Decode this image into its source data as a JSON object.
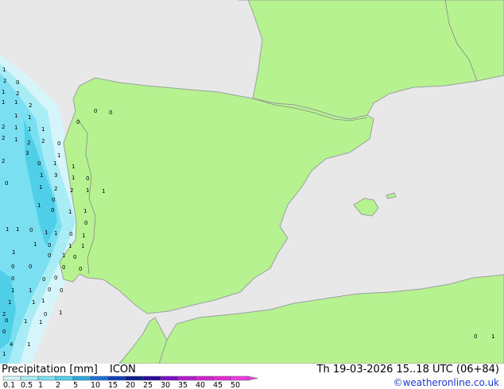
{
  "map": {
    "colors": {
      "sea": "#e8e8e8",
      "land": "#b6f28f",
      "coast": "#9aa0a0",
      "border": "#888888"
    },
    "cell_values": [
      "1",
      "0",
      "2",
      "2",
      "1",
      "1",
      "1",
      "2",
      "1",
      "1",
      "2",
      "1",
      "1",
      "1",
      "2",
      "0",
      "1",
      "2",
      "2",
      "1",
      "3",
      "0",
      "1",
      "2",
      "1",
      "3",
      "1",
      "1",
      "0",
      "1",
      "0",
      "1",
      "2",
      "2",
      "1",
      "0",
      "1",
      "0",
      "1",
      "1",
      "0",
      "1",
      "1",
      "0",
      "1",
      "1",
      "0",
      "1",
      "1",
      "0",
      "1",
      "1",
      "1",
      "0",
      "1",
      "0",
      "0",
      "0",
      "0",
      "0",
      "0",
      "0",
      "0",
      "0",
      "1",
      "1",
      "0",
      "1",
      "1",
      "1",
      "2",
      "1",
      "0",
      "1",
      "1",
      "0",
      "4",
      "1",
      "1",
      "0",
      "0",
      "1",
      "0",
      "0",
      "0"
    ]
  },
  "footer": {
    "legend_title": "Precipitation [mm]",
    "model": "ICON",
    "valid_time": "Th 19-03-2026 15..18 UTC (06+84)",
    "credit": "©weatheronline.co.uk",
    "scale_labels": [
      "0.1",
      "0.5",
      "1",
      "2",
      "5",
      "10",
      "15",
      "20",
      "25",
      "30",
      "35",
      "40",
      "45",
      "50"
    ],
    "scale_colors": [
      "#d6f5fb",
      "#a8ecf5",
      "#7adff0",
      "#4fcfe8",
      "#2ba8e0",
      "#1a72d6",
      "#1140b8",
      "#0a1e8c",
      "#2a0a9a",
      "#7a10c8",
      "#b41acf",
      "#d61fcf",
      "#e62bd6",
      "#f03ce0"
    ]
  }
}
